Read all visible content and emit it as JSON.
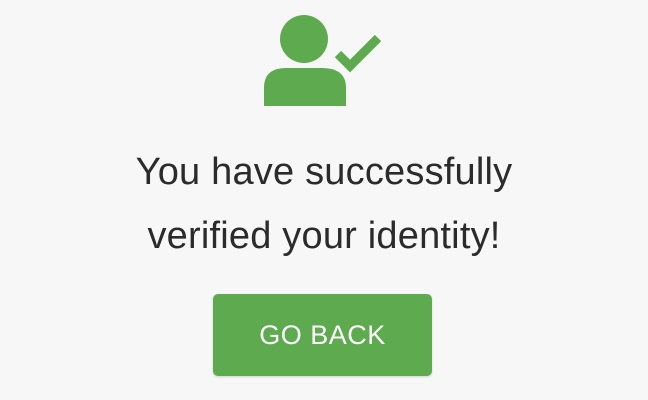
{
  "verification": {
    "icon": "user-verified-icon",
    "message_line1": "You have successfully",
    "message_line2": "verified your identity!",
    "go_back_label": "GO BACK"
  },
  "colors": {
    "accent": "#5daa4f",
    "text": "#2b2b2b",
    "background": "#f7f7f7",
    "button_text": "#ffffff"
  }
}
